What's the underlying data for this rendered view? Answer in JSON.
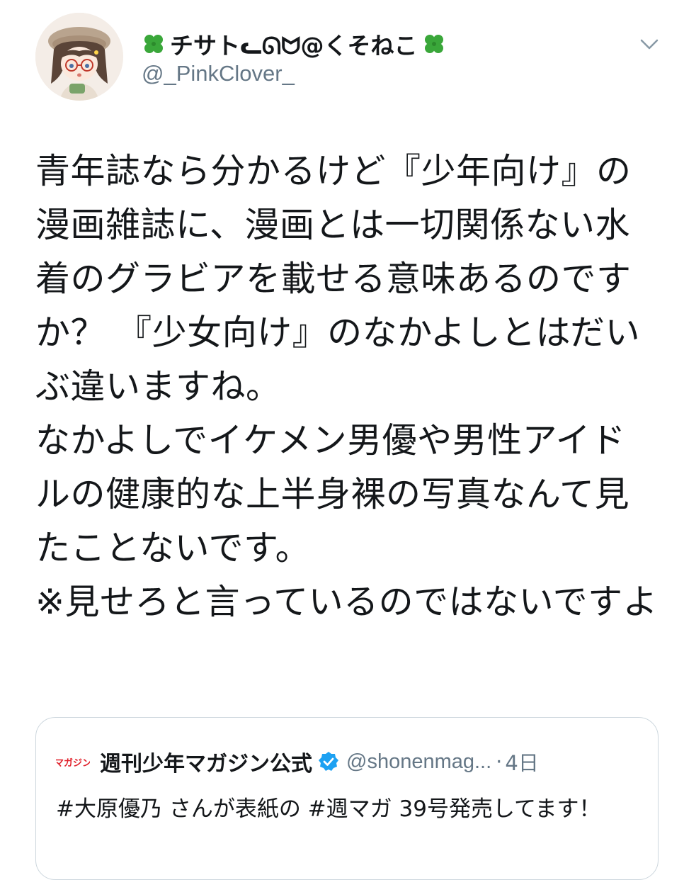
{
  "author": {
    "display_name": "チサトᓚᘏᗢ@くそねこ",
    "handle": "@_PinkClover_",
    "avatar_icon": "avatar-icon",
    "name_decoration_icon": "four-leaf-clover-icon"
  },
  "menu_icon": "chevron-down-icon",
  "tweet": {
    "text": "青年誌なら分かるけど『少年向け』の漫画雑誌に、漫画とは一切関係ない水着のグラビアを載せる意味あるのですか？ 『少女向け』のなかよしとはだいぶ違いますね。\nなかよしでイケメン男優や男性アイドルの健康的な上半身裸の写真なんて見たことないです。\n※見せろと言っているのではないですよ"
  },
  "quoted_tweet": {
    "logo_text": "マガジン",
    "author_name": "週刊少年マガジン公式",
    "verified_icon": "verified-badge-icon",
    "handle": "@shonenmag...",
    "separator": "·",
    "time": "4日",
    "text": "#大原優乃 さんが表紙の #週マガ 39号発売してます！"
  },
  "colors": {
    "text_primary": "#14171a",
    "text_secondary": "#657786",
    "border": "#ccd6dd",
    "verified_blue": "#1da1f2",
    "clover_green": "#3aa73a",
    "logo_red": "#e0202a"
  }
}
